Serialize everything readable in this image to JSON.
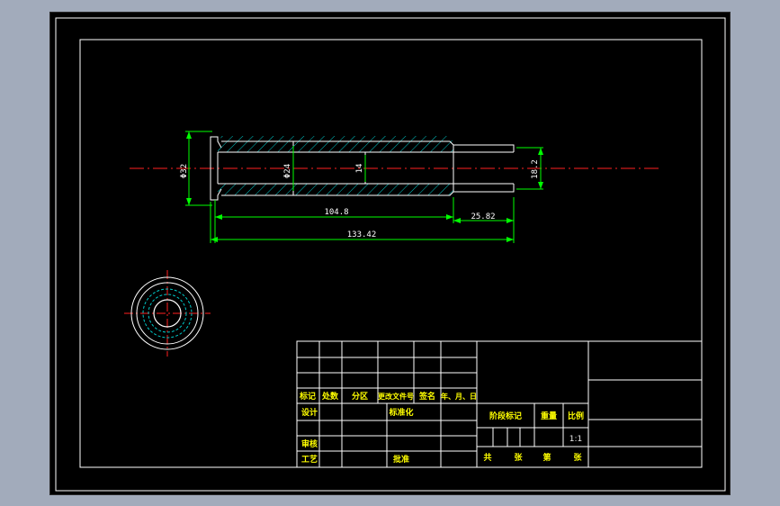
{
  "drawing": {
    "dimensions": {
      "d_flange": "Φ32",
      "d_mid": "Φ24",
      "d_bore": "14",
      "d_end": "18.2",
      "len_main": "104.8",
      "len_end": "25.82",
      "len_total": "133.42"
    }
  },
  "title_block": {
    "header": {
      "mark": "标记",
      "count": "处数",
      "zone": "分区",
      "doc_no": "更改文件号",
      "sign": "签名",
      "date": "年、月、日"
    },
    "rows": {
      "design": "设计",
      "standardize": "标准化",
      "review": "审核",
      "process": "工艺",
      "approve": "批准"
    },
    "right": {
      "stage_mark": "阶段标记",
      "weight": "重量",
      "scale": "比例",
      "scale_value": "1:1",
      "total": "共",
      "sheets1": "张",
      "page": "第",
      "sheets2": "张"
    }
  }
}
